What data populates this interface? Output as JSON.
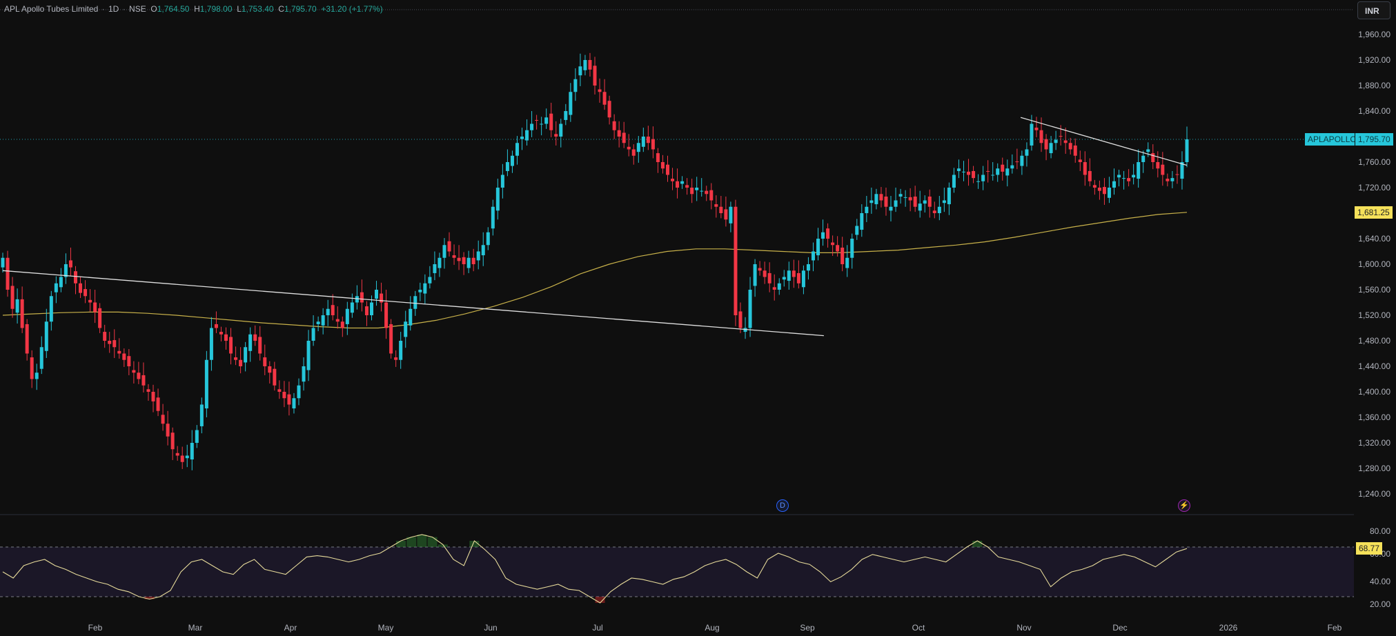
{
  "legend": {
    "symbol": "APL Apollo Tubes Limited",
    "interval": "1D",
    "exchange": "NSE",
    "open_label": "O",
    "open": "1,764.50",
    "high_label": "H",
    "high": "1,798.00",
    "low_label": "L",
    "low": "1,753.40",
    "close_label": "C",
    "close": "1,795.70",
    "change": "+31.20 (+1.77%)"
  },
  "currency_button": "INR",
  "price_axis": [
    "1,960.00",
    "1,920.00",
    "1,880.00",
    "1,840.00",
    "1,800.00",
    "1,760.00",
    "1,720.00",
    "1,680.00",
    "1,640.00",
    "1,600.00",
    "1,560.00",
    "1,520.00",
    "1,480.00",
    "1,440.00",
    "1,400.00",
    "1,360.00",
    "1,320.00",
    "1,280.00",
    "1,240.00"
  ],
  "rsi_axis": [
    "80.00",
    "60.00",
    "40.00",
    "20.00"
  ],
  "time_axis": [
    "Feb",
    "Mar",
    "Apr",
    "May",
    "Jun",
    "Jul",
    "Aug",
    "Sep",
    "Oct",
    "Nov",
    "Dec",
    "2026",
    "Feb"
  ],
  "tags": {
    "symbol": "APLAPOLLO",
    "last_price": "1,795.70",
    "ma_value": "1,681.25",
    "rsi_value": "68.77"
  },
  "badges": {
    "dividend": "D",
    "earnings": "⚡"
  },
  "badge_icons": {
    "dividend": "dividend-icon",
    "earnings": "lightning-icon"
  },
  "colors": {
    "up": "#26c6da",
    "down": "#f23645",
    "ma": "#c9b24a",
    "rsi": "#e8dc9b",
    "trendline": "#e0e0e0",
    "rsi_band": "#7e57c2"
  },
  "chart_data": {
    "type": "candlestick",
    "series_name": "",
    "ylim": [
      1220,
      1980
    ],
    "close": [
      1610,
      1560,
      1530,
      1545,
      1500,
      1460,
      1420,
      1430,
      1470,
      1510,
      1550,
      1570,
      1580,
      1600,
      1595,
      1570,
      1555,
      1550,
      1540,
      1525,
      1500,
      1480,
      1475,
      1470,
      1460,
      1450,
      1440,
      1430,
      1420,
      1410,
      1400,
      1385,
      1370,
      1350,
      1330,
      1310,
      1300,
      1290,
      1300,
      1320,
      1340,
      1380,
      1450,
      1500,
      1500,
      1490,
      1480,
      1460,
      1450,
      1440,
      1470,
      1490,
      1480,
      1460,
      1440,
      1430,
      1410,
      1400,
      1390,
      1380,
      1390,
      1410,
      1440,
      1480,
      1500,
      1510,
      1520,
      1530,
      1520,
      1510,
      1500,
      1530,
      1540,
      1550,
      1540,
      1520,
      1540,
      1560,
      1540,
      1500,
      1460,
      1450,
      1480,
      1510,
      1530,
      1550,
      1560,
      1570,
      1580,
      1600,
      1610,
      1630,
      1620,
      1610,
      1605,
      1600,
      1610,
      1600,
      1620,
      1630,
      1650,
      1690,
      1720,
      1740,
      1760,
      1770,
      1790,
      1800,
      1810,
      1820,
      1825,
      1820,
      1830,
      1810,
      1800,
      1820,
      1840,
      1870,
      1890,
      1910,
      1920,
      1905,
      1880,
      1870,
      1850,
      1830,
      1810,
      1800,
      1790,
      1780,
      1770,
      1790,
      1800,
      1790,
      1780,
      1760,
      1750,
      1740,
      1730,
      1720,
      1730,
      1720,
      1710,
      1720,
      1715,
      1710,
      1700,
      1690,
      1680,
      1670,
      1690,
      1520,
      1500,
      1500,
      1560,
      1600,
      1590,
      1580,
      1570,
      1560,
      1570,
      1580,
      1590,
      1580,
      1570,
      1590,
      1600,
      1620,
      1640,
      1650,
      1640,
      1630,
      1620,
      1600,
      1610,
      1640,
      1660,
      1680,
      1690,
      1700,
      1710,
      1700,
      1690,
      1690,
      1700,
      1710,
      1705,
      1700,
      1690,
      1695,
      1700,
      1690,
      1680,
      1690,
      1700,
      1720,
      1740,
      1750,
      1745,
      1740,
      1735,
      1730,
      1740,
      1745,
      1740,
      1750,
      1745,
      1750,
      1755,
      1760,
      1770,
      1780,
      1820,
      1810,
      1790,
      1780,
      1790,
      1795,
      1800,
      1790,
      1780,
      1770,
      1760,
      1740,
      1730,
      1720,
      1715,
      1710,
      1720,
      1730,
      1740,
      1735,
      1730,
      1740,
      1760,
      1770,
      1780,
      1760,
      1750,
      1740,
      1730,
      1735,
      1740,
      1760,
      1795.7
    ],
    "ma_200": [
      1520,
      1522,
      1524,
      1525,
      1525,
      1523,
      1520,
      1516,
      1512,
      1508,
      1505,
      1502,
      1500,
      1500,
      1505,
      1512,
      1522,
      1534,
      1548,
      1565,
      1585,
      1600,
      1612,
      1620,
      1624,
      1624,
      1622,
      1620,
      1618,
      1618,
      1620,
      1622,
      1626,
      1630,
      1635,
      1642,
      1650,
      1658,
      1665,
      1672,
      1678,
      1681.25
    ],
    "rsi": [
      50,
      45,
      55,
      58,
      60,
      55,
      52,
      48,
      45,
      42,
      40,
      36,
      34,
      30,
      28,
      30,
      35,
      50,
      58,
      60,
      55,
      50,
      48,
      56,
      60,
      52,
      50,
      48,
      55,
      62,
      63,
      62,
      60,
      58,
      60,
      63,
      65,
      70,
      75,
      78,
      80,
      78,
      72,
      60,
      55,
      75,
      68,
      60,
      45,
      40,
      38,
      36,
      38,
      40,
      36,
      35,
      30,
      25,
      34,
      40,
      45,
      44,
      42,
      40,
      44,
      46,
      50,
      55,
      58,
      60,
      56,
      50,
      45,
      60,
      65,
      62,
      58,
      56,
      50,
      42,
      46,
      52,
      60,
      64,
      62,
      60,
      58,
      60,
      62,
      60,
      58,
      64,
      70,
      75,
      70,
      62,
      60,
      58,
      55,
      52,
      38,
      45,
      50,
      52,
      55,
      60,
      62,
      64,
      62,
      58,
      54,
      60,
      66,
      68.77
    ],
    "trendlines": [
      {
        "from": [
          "2025-01-01",
          1590
        ],
        "to": [
          "2025-08-31",
          1488
        ]
      },
      {
        "from": [
          "2025-10-28",
          1830
        ],
        "to": [
          "2025-12-16",
          1755
        ]
      }
    ]
  }
}
